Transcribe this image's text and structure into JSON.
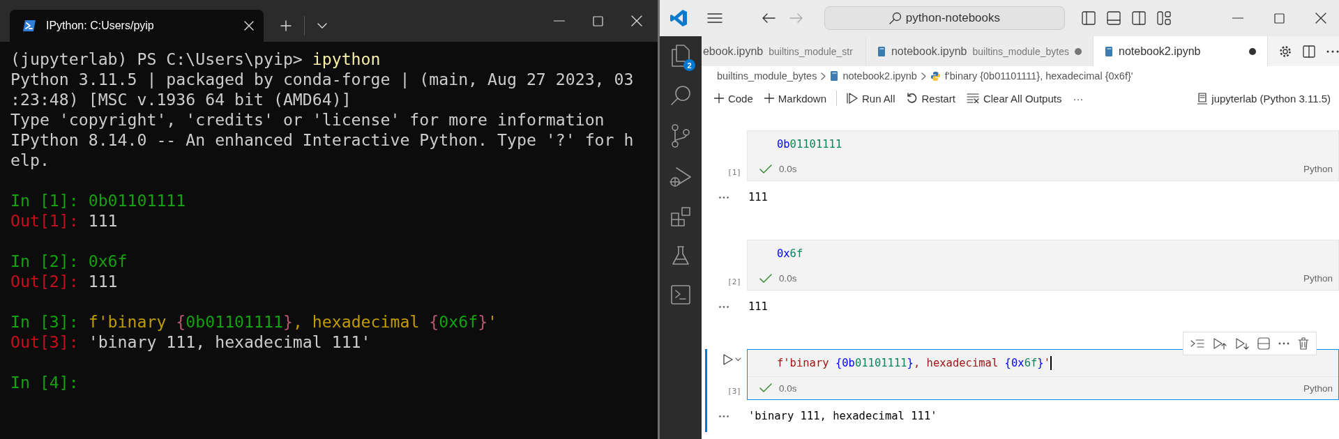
{
  "terminal": {
    "tab": {
      "title": "IPython: C:Users/pyip",
      "selected": true
    },
    "blocks": [
      {
        "lines": [
          [
            {
              "kind": "plain",
              "text": "(jupyterlab) PS C:\\Users\\pyip> "
            },
            {
              "kind": "command",
              "text": "ipython"
            }
          ],
          [
            {
              "kind": "plain",
              "text": "Python 3.11.5 | packaged by conda-forge | (main, Aug 27 2023, 03"
            }
          ],
          [
            {
              "kind": "plain",
              "text": ":23:48) [MSC v.1936 64 bit (AMD64)]"
            }
          ],
          [
            {
              "kind": "plain",
              "text": "Type 'copyright', 'credits' or 'license' for more information"
            }
          ],
          [
            {
              "kind": "plain",
              "text": "IPython 8.14.0 -- An enhanced Interactive Python. Type '?' for h"
            }
          ],
          [
            {
              "kind": "plain",
              "text": "elp."
            }
          ]
        ]
      },
      {
        "lines": [
          [
            {
              "kind": "in",
              "text": "In [1]: "
            },
            {
              "kind": "number",
              "text": "0b01101111"
            }
          ],
          [
            {
              "kind": "out",
              "text": "Out[1]: "
            },
            {
              "kind": "plain",
              "text": "111"
            }
          ]
        ]
      },
      {
        "lines": [
          [
            {
              "kind": "in",
              "text": "In [2]: "
            },
            {
              "kind": "number",
              "text": "0x6f"
            }
          ],
          [
            {
              "kind": "out",
              "text": "Out[2]: "
            },
            {
              "kind": "plain",
              "text": "111"
            }
          ]
        ]
      },
      {
        "lines": [
          [
            {
              "kind": "in",
              "text": "In [3]: "
            },
            {
              "kind": "string",
              "text": "f'binary "
            },
            {
              "kind": "brace",
              "text": "{"
            },
            {
              "kind": "number",
              "text": "0b01101111"
            },
            {
              "kind": "brace",
              "text": "}"
            },
            {
              "kind": "string",
              "text": ", hexadecimal "
            },
            {
              "kind": "brace",
              "text": "{"
            },
            {
              "kind": "number",
              "text": "0x6f"
            },
            {
              "kind": "brace",
              "text": "}"
            },
            {
              "kind": "string",
              "text": "'"
            }
          ],
          [
            {
              "kind": "out",
              "text": "Out[3]: "
            },
            {
              "kind": "plain",
              "text": "'binary 111, hexadecimal 111'"
            }
          ]
        ]
      },
      {
        "lines": [
          [
            {
              "kind": "in",
              "text": "In [4]:"
            }
          ]
        ]
      }
    ]
  },
  "editor": {
    "search": "python-notebooks",
    "explorer_badge": "2",
    "tabs": [
      {
        "label": "ebook.ipynb",
        "description": "builtins_module_str",
        "selected": false,
        "dirty": false,
        "clipped": true
      },
      {
        "label": "notebook.ipynb",
        "description": "builtins_module_bytes",
        "selected": false,
        "dirty": true,
        "clipped": false
      },
      {
        "label": "notebook2.ipynb",
        "selected": true,
        "dirty": true,
        "clipped": false
      }
    ],
    "breadcrumbs": [
      {
        "kind": "folder",
        "text": "builtins_module_bytes"
      },
      {
        "kind": "notebook",
        "text": "notebook2.ipynb"
      },
      {
        "kind": "cell",
        "text": "f'binary {0b01101111}, hexadecimal {0x6f}'"
      }
    ],
    "toolbar": [
      {
        "kind": "add",
        "label": "Code"
      },
      {
        "kind": "add",
        "label": "Markdown"
      },
      {
        "kind": "run",
        "label": "Run All"
      },
      {
        "kind": "restart",
        "label": "Restart"
      },
      {
        "kind": "clear",
        "label": "Clear All Outputs"
      },
      {
        "kind": "more",
        "label": "···"
      }
    ],
    "kernel": "jupyterlab (Python 3.11.5)",
    "cells": [
      {
        "count": "[1]",
        "time": "0.0s",
        "language": "Python",
        "selected": false,
        "code": [
          {
            "kind": "prefix",
            "text": "0b"
          },
          {
            "kind": "number",
            "text": "01101111"
          }
        ],
        "output": "111"
      },
      {
        "count": "[2]",
        "time": "0.0s",
        "language": "Python",
        "selected": false,
        "code": [
          {
            "kind": "prefix",
            "text": "0x"
          },
          {
            "kind": "number",
            "text": "6f"
          }
        ],
        "output": "111"
      },
      {
        "count": "[3]",
        "time": "0.0s",
        "language": "Python",
        "selected": true,
        "code": [
          {
            "kind": "string",
            "text": "f'binary "
          },
          {
            "kind": "brace",
            "text": "{"
          },
          {
            "kind": "prefix",
            "text": "0b"
          },
          {
            "kind": "number",
            "text": "01101111"
          },
          {
            "kind": "brace",
            "text": "}"
          },
          {
            "kind": "string",
            "text": ", hexadecimal "
          },
          {
            "kind": "brace",
            "text": "{"
          },
          {
            "kind": "prefix",
            "text": "0x"
          },
          {
            "kind": "number",
            "text": "6f"
          },
          {
            "kind": "brace",
            "text": "}"
          },
          {
            "kind": "string",
            "text": "'"
          }
        ],
        "output": "'binary 111, hexadecimal 111'"
      }
    ]
  }
}
